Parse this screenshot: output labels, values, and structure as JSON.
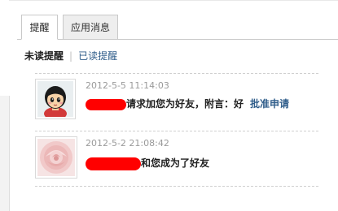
{
  "tabs": [
    {
      "label": "提醒",
      "active": true
    },
    {
      "label": "应用消息",
      "active": false
    }
  ],
  "subnav": {
    "unread": "未读提醒",
    "read": "已读提醒"
  },
  "notifications": [
    {
      "time": "2012-5-5 11:14:03",
      "message": "请求加您为好友，附言：好",
      "action": "批准申请",
      "avatar": "cartoon-girl-avatar"
    },
    {
      "time": "2012-5-2 21:08:42",
      "message": "和您成为了好友",
      "avatar": "pink-rose-avatar"
    }
  ],
  "colors": {
    "link": "#2f5d8a",
    "redaction": "#ff0000",
    "timestamp": "#9a9a9a"
  }
}
